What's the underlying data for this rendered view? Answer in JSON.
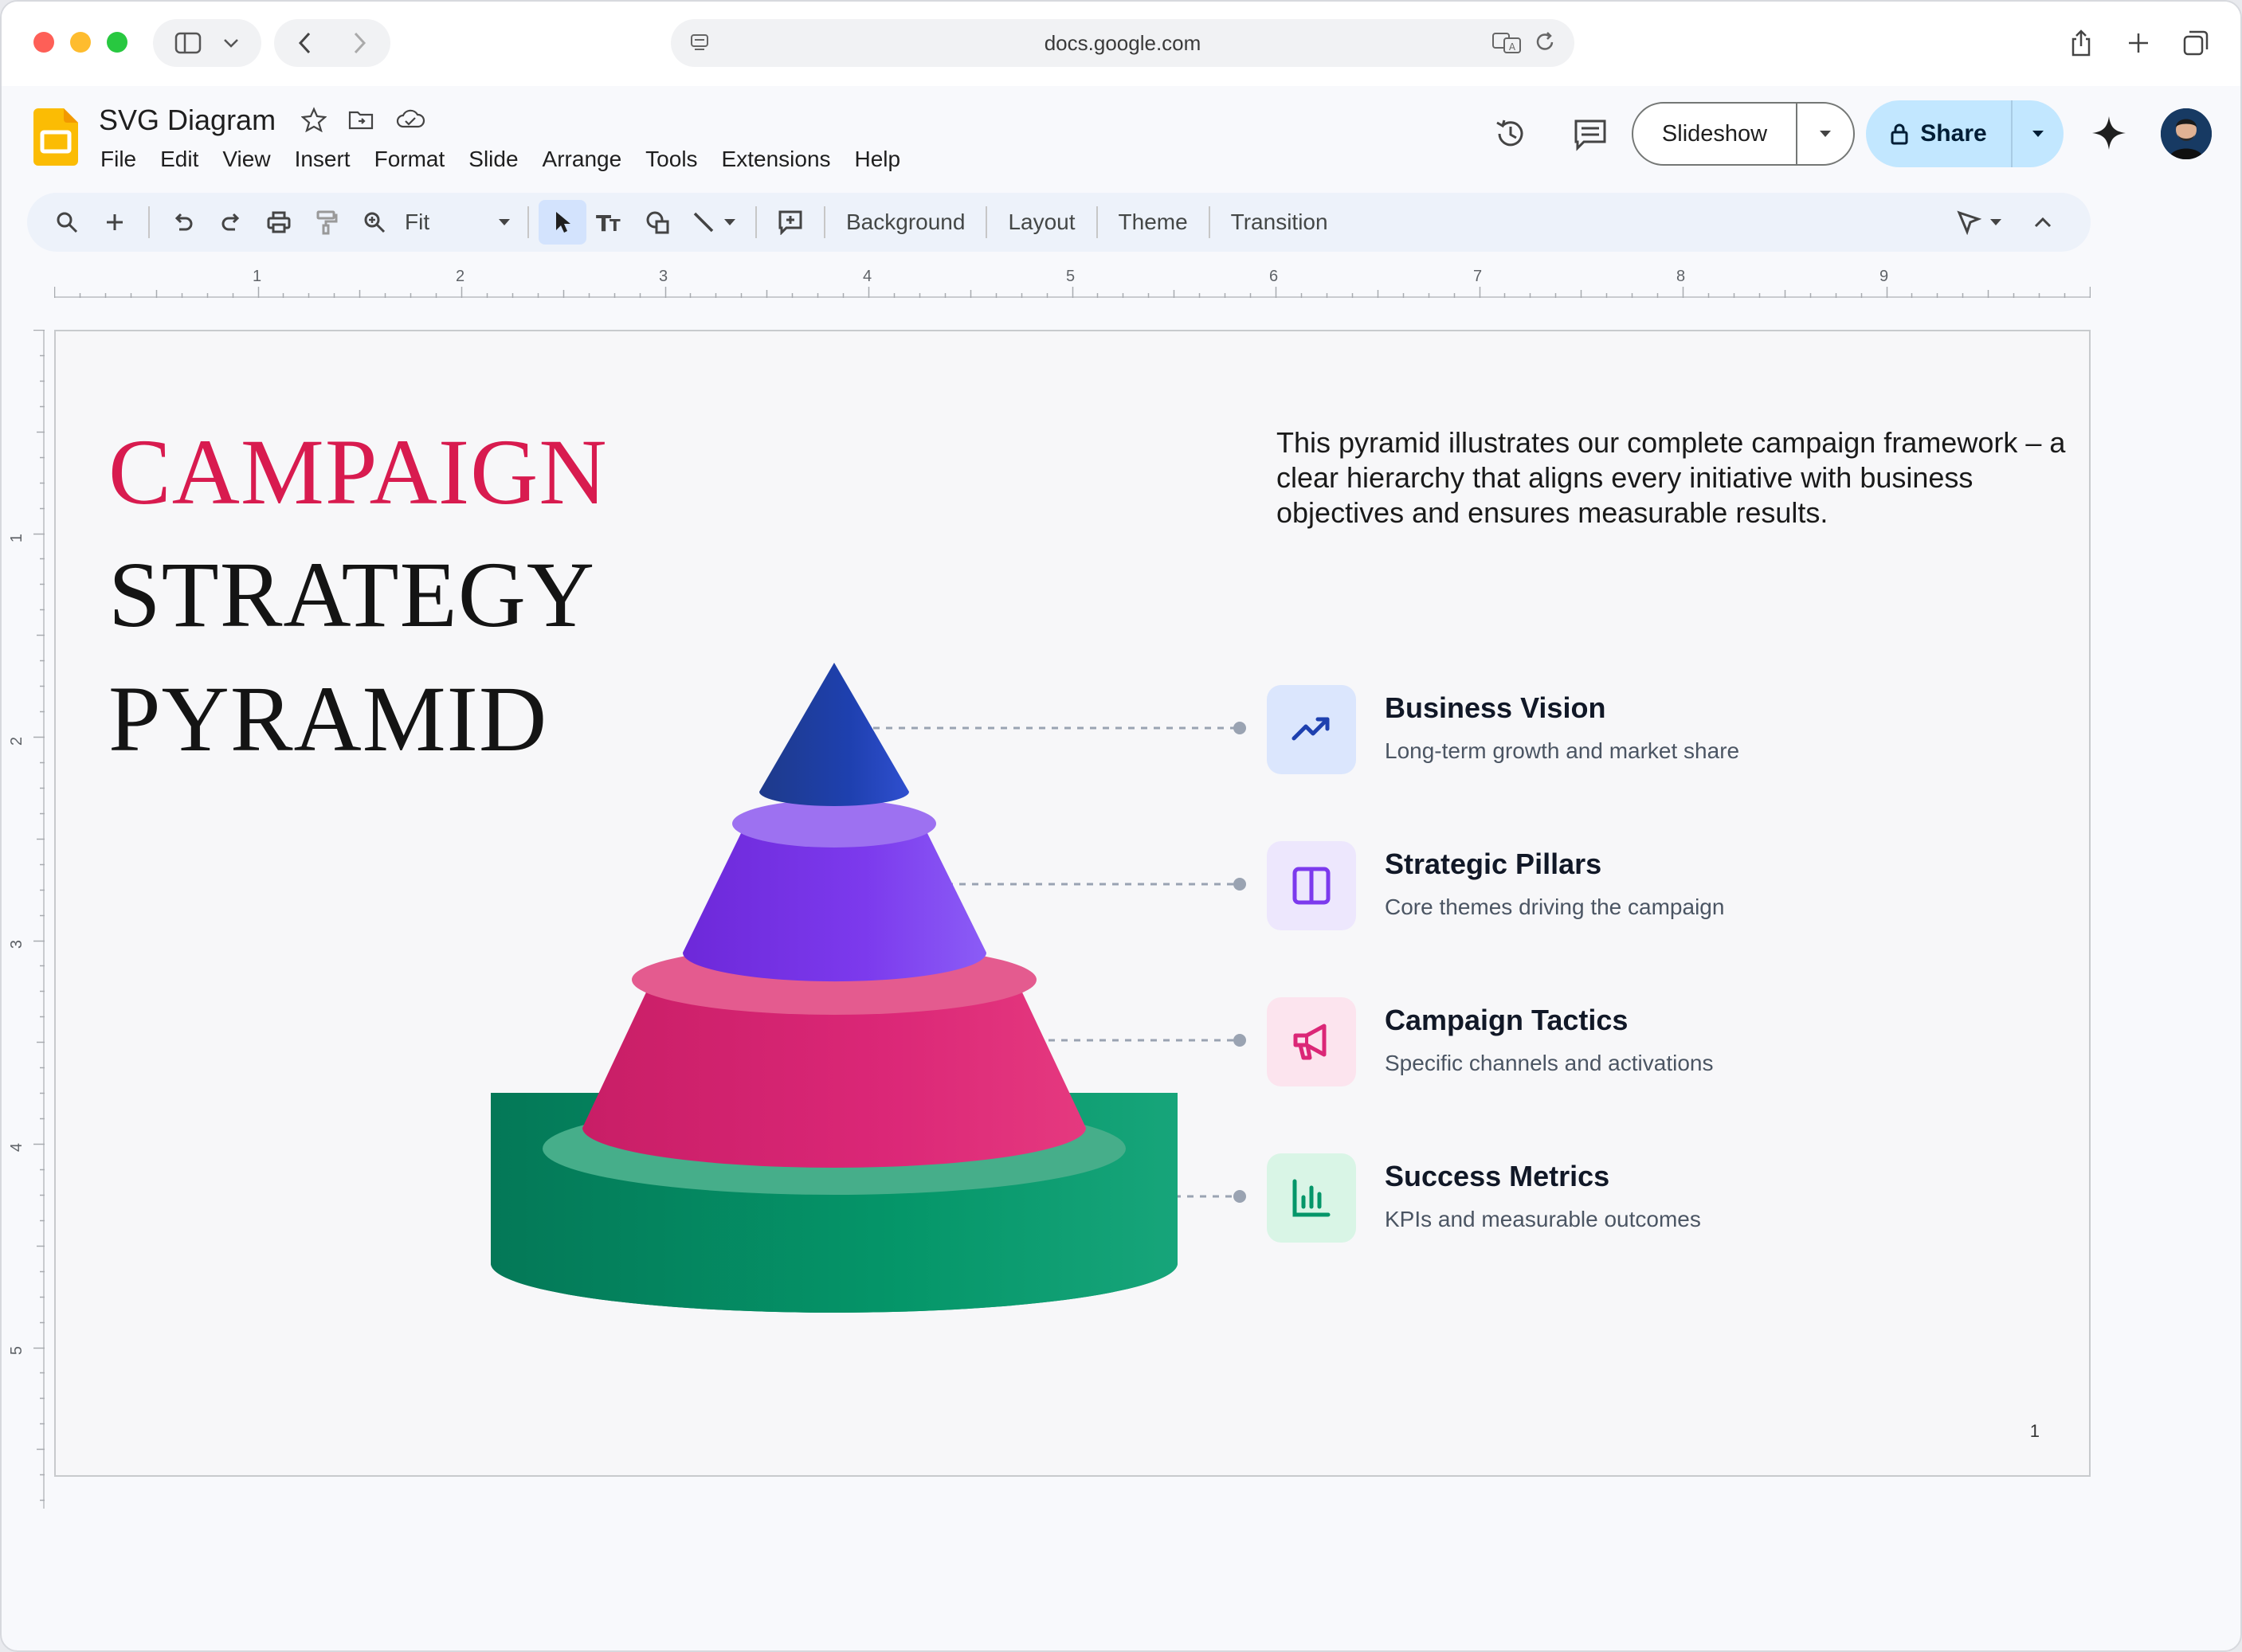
{
  "browser": {
    "url": "docs.google.com"
  },
  "doc": {
    "title": "SVG Diagram",
    "menus": [
      "File",
      "Edit",
      "View",
      "Insert",
      "Format",
      "Slide",
      "Arrange",
      "Tools",
      "Extensions",
      "Help"
    ]
  },
  "header": {
    "slideshow_label": "Slideshow",
    "share_label": "Share"
  },
  "toolbar": {
    "zoom_label": "Fit",
    "background_label": "Background",
    "layout_label": "Layout",
    "theme_label": "Theme",
    "transition_label": "Transition"
  },
  "rulers": {
    "horizontal": [
      "1",
      "2",
      "3",
      "4",
      "5",
      "6",
      "7",
      "8",
      "9"
    ],
    "vertical": [
      "1",
      "2",
      "3",
      "4",
      "5"
    ]
  },
  "slide": {
    "title_lines": [
      "CAMPAIGN",
      "STRATEGY",
      "PYRAMID"
    ],
    "intro": "This pyramid illustrates our complete campaign framework – a clear hierarchy that aligns every initiative with business objectives and ensures measurable results.",
    "levels": [
      {
        "title": "Business Vision",
        "description": "Long-term growth and market share",
        "icon": "trending-up-icon",
        "color": "#1e40af"
      },
      {
        "title": "Strategic Pillars",
        "description": "Core themes driving the campaign",
        "icon": "columns-icon",
        "color": "#7c3aed"
      },
      {
        "title": "Campaign Tactics",
        "description": "Specific channels and activations",
        "icon": "megaphone-icon",
        "color": "#db2777"
      },
      {
        "title": "Success Metrics",
        "description": "KPIs and measurable outcomes",
        "icon": "bar-chart-icon",
        "color": "#059669"
      }
    ],
    "page_number": "1"
  },
  "colors": {
    "accent_red": "#d81b4f",
    "share_bg": "#c2e7ff",
    "tier_blue": "#1e40af",
    "tier_purple": "#7c3aed",
    "tier_pink": "#db2777",
    "tier_green": "#059669"
  }
}
